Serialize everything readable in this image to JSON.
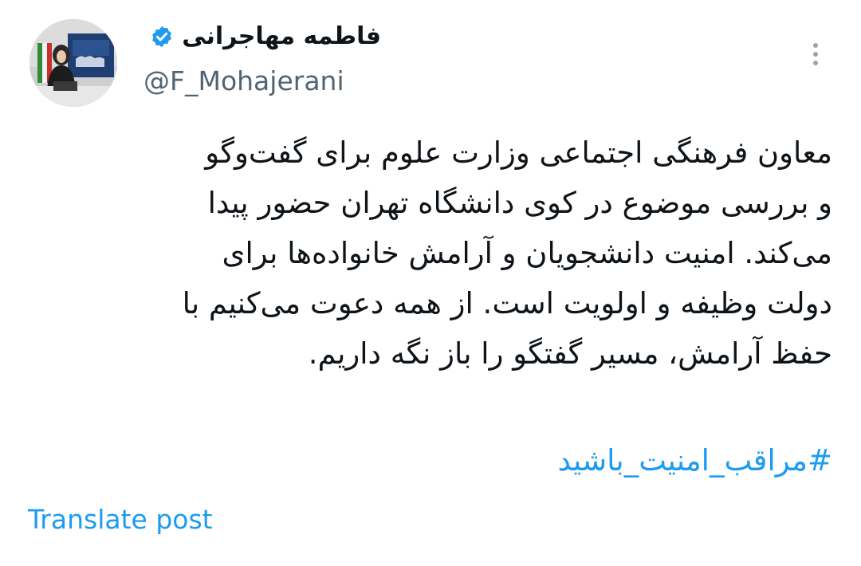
{
  "post": {
    "author": {
      "display_name": "فاطمه مهاجرانی",
      "handle": "@F_Mohajerani",
      "verified": true,
      "verified_icon": "verified-badge-icon"
    },
    "more_icon": "more-vertical-icon",
    "body_lines": [
      "معاون فرهنگی اجتماعی وزارت علوم برای گفت‌وگو",
      "و بررسی موضوع در کوی دانشگاه تهران حضور پیدا",
      "می‌کند. امنیت دانشجویان و آرامش خانواده‌ها برای",
      "دولت وظیفه و اولویت است. از همه دعوت می‌کنیم با",
      "حفظ آرامش، مسیر گفتگو را باز نگه داریم."
    ],
    "hashtag": "#مراقب_امنیت_باشید",
    "translate_label": "Translate post"
  },
  "colors": {
    "text": "#0f1419",
    "secondary_text": "#536471",
    "link": "#1d9bf0",
    "verified": "#1d9bf0",
    "background": "#ffffff"
  }
}
